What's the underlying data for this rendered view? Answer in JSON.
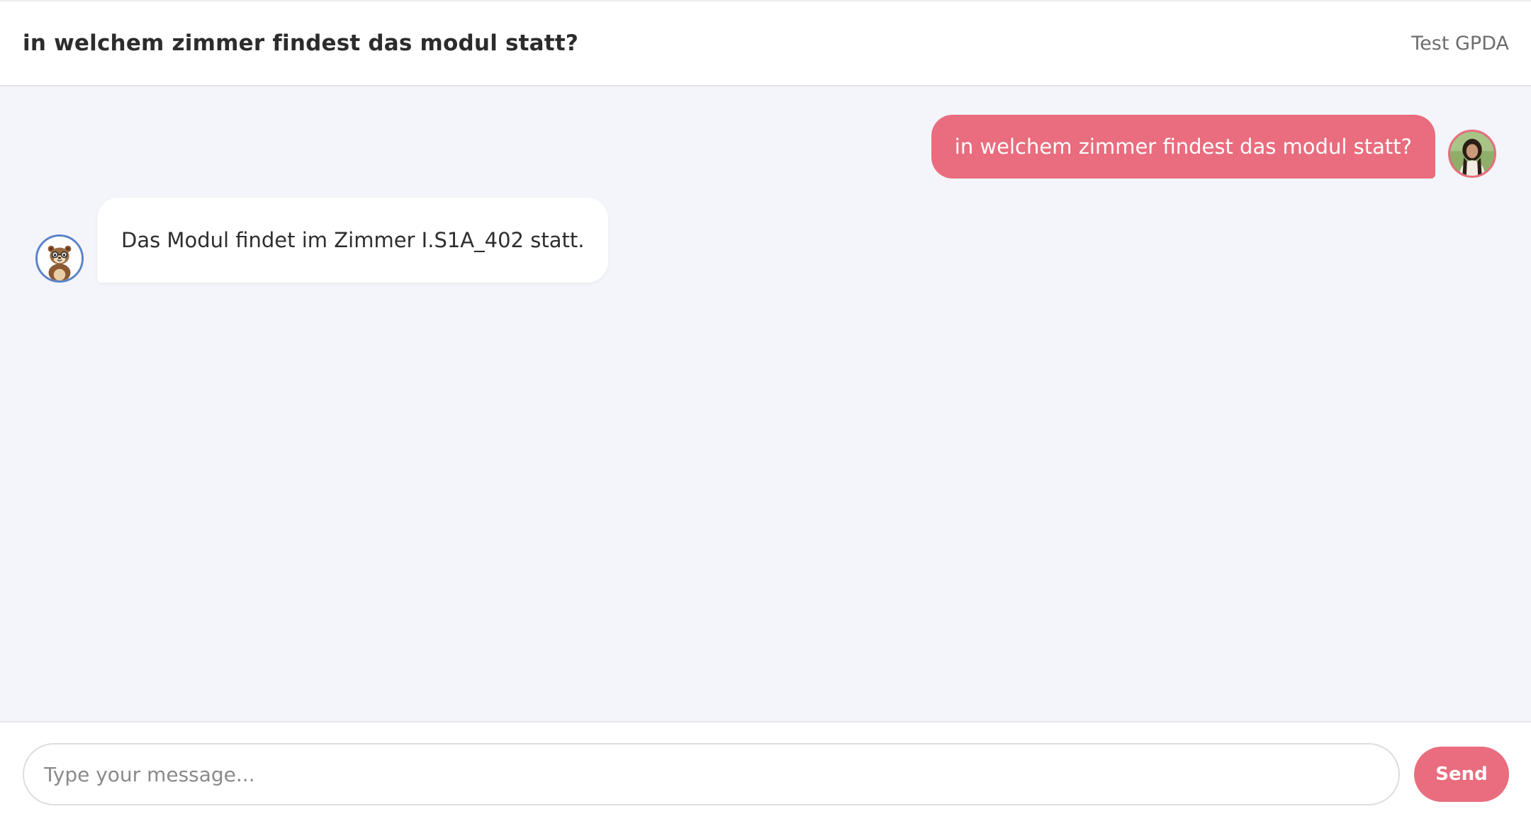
{
  "header": {
    "title": "in welchem zimmer findest das modul statt?",
    "user_label": "Test GPDA"
  },
  "messages": [
    {
      "role": "user",
      "text": "in welchem zimmer findest das modul statt?",
      "avatar_icon": "user-avatar-photo"
    },
    {
      "role": "assistant",
      "text": "Das Modul findet im Zimmer I.S1A_402 statt.",
      "avatar_icon": "otter-avatar-icon"
    }
  ],
  "composer": {
    "placeholder": "Type your message...",
    "value": "",
    "send_label": "Send"
  },
  "colors": {
    "accent": "#e96d7e",
    "chat_background": "#f4f5fa",
    "bot_avatar_ring": "#5b82c8"
  }
}
